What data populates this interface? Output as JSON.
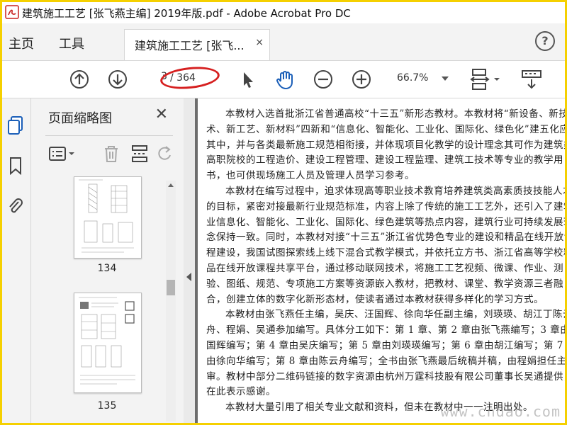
{
  "window": {
    "title": "建筑施工工艺 [张飞燕主编] 2019年版.pdf - Adobe Acrobat Pro DC"
  },
  "menu": {
    "home": "主页",
    "tools": "工具"
  },
  "tab": {
    "label": "建筑施工工艺 [张飞...",
    "close": "×"
  },
  "help": "?",
  "toolbar": {
    "page_current": "3",
    "page_total": "/ 364",
    "zoom": "66.7%"
  },
  "panel": {
    "title": "页面缩略图",
    "close": "✕",
    "thumbs": [
      {
        "number": "134"
      },
      {
        "number": "135"
      }
    ]
  },
  "document": {
    "paragraphs": [
      "本教材入选首批浙江省普通高校“十三五”新形态教材。本教材将“新设备、新技术、新工艺、新材料”四新和“信息化、智能化、工业化、国际化、绿色化”建五化应用其中，并与各类最新施工规范相衔接，并体现项目化教学的设计理念其可作为建筑类高职院校的工程造价、建设工程管理、建设工程监理、建筑工技术等专业的教学用书，也可供现场施工人员及管理人员学习参考。",
      "本教材在编写过程中，迫求体现高等职业技术教育培养建筑类高素质技技能人才的目标，紧密对接最新行业规范标准，内容上除了传统的施工工艺外，还引入了建筑业信息化、智能化、工业化、国际化、绿色建筑等热点内容，建筑行业可持续发展理念保持一致。同时，本教材对接“十三五”浙江省优势色专业的建设和精品在线开放课程建设，我国试图探索线上线下混合式教学模式，并依托立方书、浙江省高等学校精品在线开放课程共享平台，通过移动联网技术，将施工工艺视频、微课、作业、测验、图纸、规范、专项施工方案等资源嵌入教材，把教材、课堂、教学资源三者融合，创建立体的数字化新形态材，使读者通过本教材获得多样化的学习方式。",
      "本教材由张飞燕任主编，吴庆、汪国辉、徐向华任副主编，刘瑛瑛、胡江丁陈云舟、程娟、吴通参加编写。具体分工如下：第 1 章、第 2 章由张飞燕编写；3 章由汪国辉编写；第 4 章由吴庆编写；第 5 章由刘瑛瑛编写；第 6 章由胡江编写；第 7 章由徐向华编写；第 8 章由陈云舟编写；全书由张飞燕最后统稿并稿，由程娟担任主审。教材中部分二维码链接的数字资源由杭州万霆科技股有限公司董事长吴通提供，在此表示感谢。",
      "本教材大量引用了相关专业文献和资料，但未在教材中一一注明出处。"
    ],
    "watermark": "www.cndao.com"
  }
}
